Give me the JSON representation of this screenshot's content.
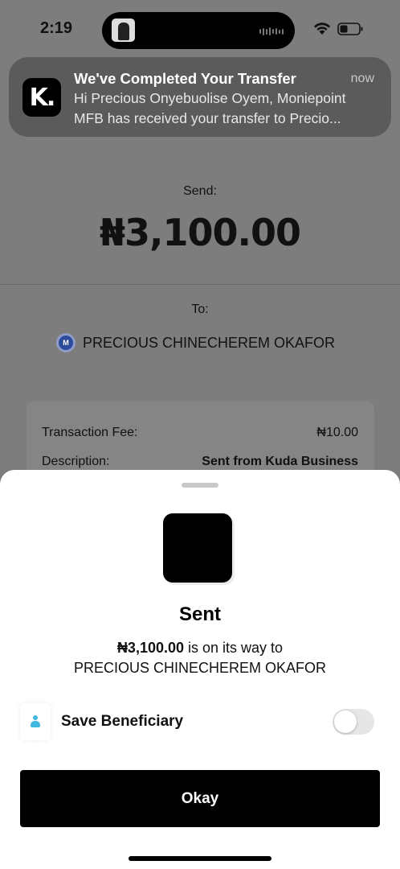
{
  "status_bar": {
    "time": "2:19"
  },
  "notification": {
    "app_icon_text": "K.",
    "title": "We've Completed Your Transfer",
    "time": "now",
    "body_line1": "Hi Precious Onyebuolise Oyem, Moniepoint",
    "body_line2": "MFB has received your transfer to Precio..."
  },
  "transfer": {
    "send_label": "Send:",
    "amount": "₦3,100.00",
    "to_label": "To:",
    "bank_badge": "M",
    "recipient": "PRECIOUS CHINECHEREM OKAFOR",
    "details": [
      {
        "label": "Transaction Fee:",
        "value": "₦10.00"
      },
      {
        "label": "Description:",
        "value": "Sent from Kuda Business"
      }
    ]
  },
  "sheet": {
    "title": "Sent",
    "amount": "₦3,100.00",
    "message_mid": " is on its way to",
    "recipient": "PRECIOUS CHINECHEREM OKAFOR",
    "save_label": "Save Beneficiary",
    "save_enabled": false,
    "okay_label": "Okay"
  },
  "colors": {
    "accent_person_icon": "#3fb8e0",
    "button_bg": "#000000",
    "overlay_bg": "#7d7d7d"
  }
}
